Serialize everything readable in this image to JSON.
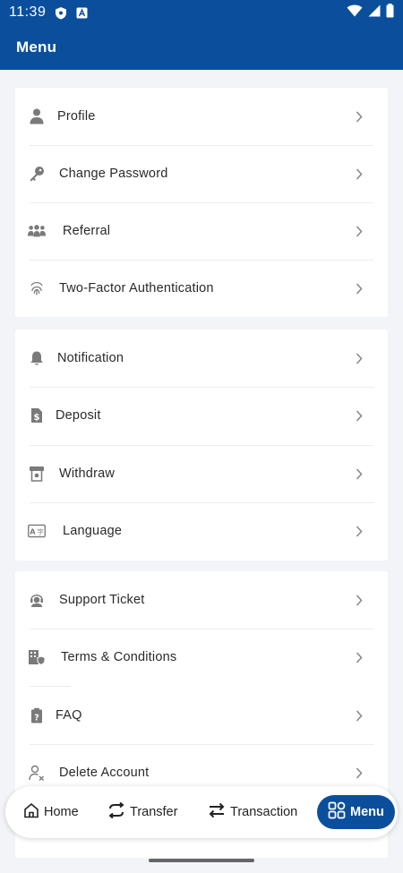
{
  "status_bar": {
    "time": "11:39",
    "icons": [
      "shield-icon",
      "a-box-icon",
      "wifi-icon",
      "signal-icon",
      "battery-icon"
    ]
  },
  "app_bar": {
    "title": "Menu"
  },
  "menu": {
    "groups": [
      {
        "items": [
          {
            "label": "Profile",
            "icon": "person-icon"
          },
          {
            "label": "Change Password",
            "icon": "key-icon"
          },
          {
            "label": "Referral",
            "icon": "people-group-icon"
          },
          {
            "label": "Two-Factor Authentication",
            "icon": "fingerprint-icon"
          }
        ]
      },
      {
        "items": [
          {
            "label": "Notification",
            "icon": "bell-icon"
          },
          {
            "label": "Deposit",
            "icon": "dollar-document-icon"
          },
          {
            "label": "Withdraw",
            "icon": "atm-icon"
          },
          {
            "label": "Language",
            "icon": "language-icon"
          }
        ]
      },
      {
        "items": [
          {
            "label": "Support Ticket",
            "icon": "support-agent-icon"
          },
          {
            "label": "Terms & Conditions",
            "icon": "building-shield-icon"
          },
          {
            "label": "FAQ",
            "icon": "question-clipboard-icon"
          },
          {
            "label": "Delete Account",
            "icon": "person-remove-icon"
          }
        ]
      }
    ]
  },
  "bottom_nav": {
    "items": [
      {
        "label": "Home",
        "icon": "home-icon",
        "active": false
      },
      {
        "label": "Transfer",
        "icon": "transfer-icon",
        "active": false
      },
      {
        "label": "Transaction",
        "icon": "swap-icon",
        "active": false
      },
      {
        "label": "Menu",
        "icon": "grid-icon",
        "active": true
      }
    ]
  },
  "colors": {
    "primary": "#0b4f9c",
    "background": "#f2f4f7",
    "icon_gray": "#7a7a7a",
    "chevron": "#8a8a8a"
  }
}
